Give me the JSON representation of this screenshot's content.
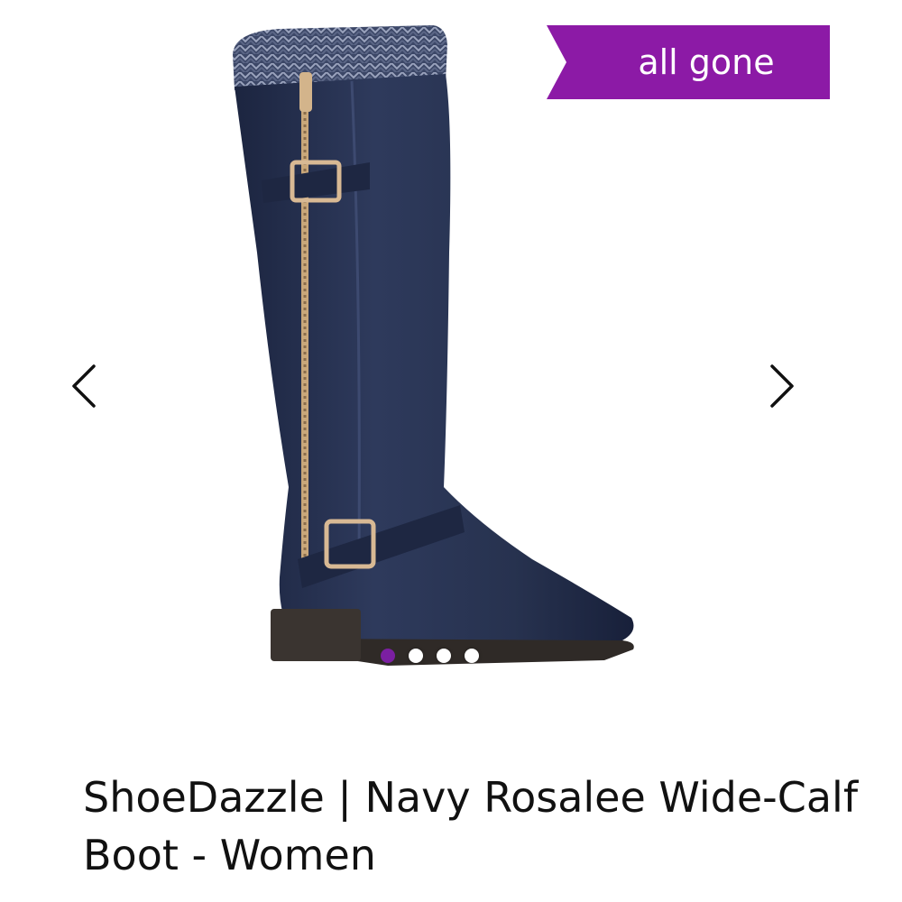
{
  "badge": {
    "label": "all gone",
    "color": "#8c1aa6"
  },
  "carousel": {
    "prev_icon": "chevron-left-icon",
    "next_icon": "chevron-right-icon",
    "image_count": 4,
    "active_index": 0,
    "active_dot_color": "#7b1fa2"
  },
  "product": {
    "title": "ShoeDazzle | Navy Rosalee Wide-Calf Boot - Women"
  }
}
